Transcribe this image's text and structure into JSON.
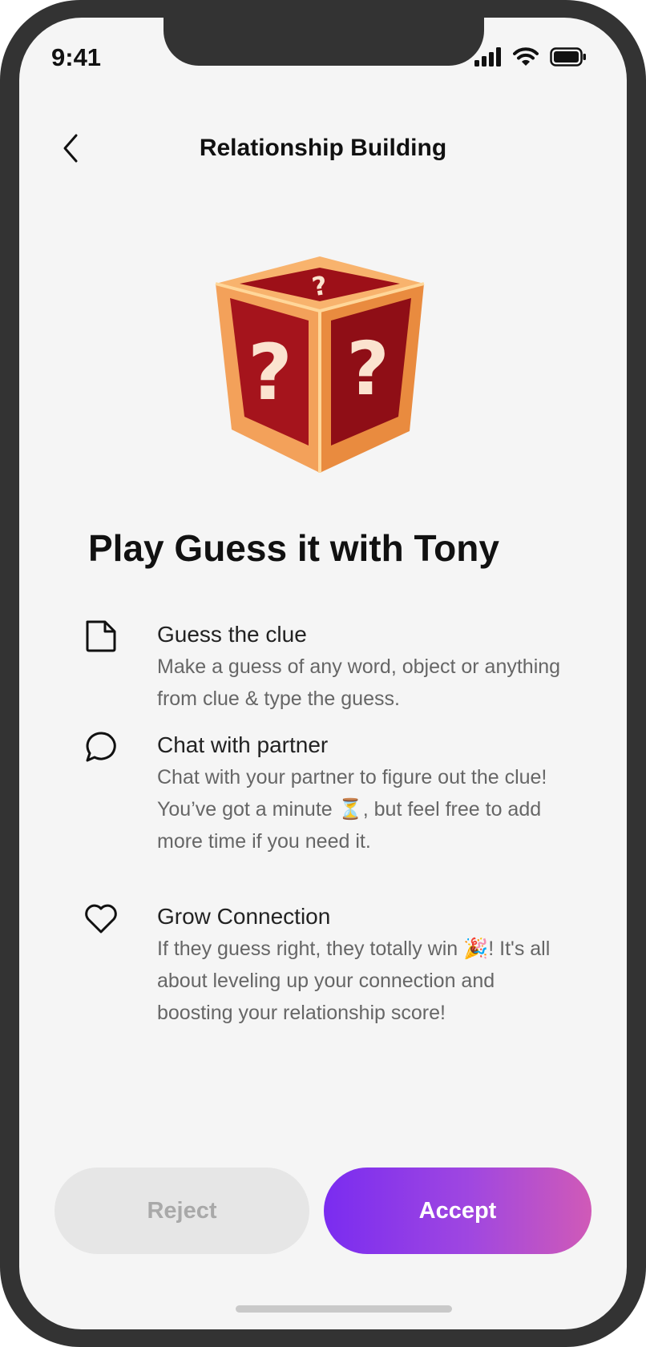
{
  "status_bar": {
    "time": "9:41"
  },
  "header": {
    "title": "Relationship Building"
  },
  "main": {
    "title": "Play Guess it with Tony"
  },
  "features": [
    {
      "icon": "document-icon",
      "title": "Guess the clue",
      "description": "Make a guess of any word, object or anything from clue & type the guess."
    },
    {
      "icon": "chat-bubble-icon",
      "title": "Chat with partner",
      "description": "Chat with your partner to figure out the clue! You’ve got a minute ⏳, but feel free to add more time if you need it."
    },
    {
      "icon": "heart-icon",
      "title": "Grow Connection",
      "description": "If they guess right, they totally win 🎉! It's all about leveling up your connection and boosting your relationship score!"
    }
  ],
  "actions": {
    "reject_label": "Reject",
    "accept_label": "Accept"
  },
  "colors": {
    "accent_start": "#7a2cf0",
    "accent_end": "#d05ab7",
    "reject_bg": "#e6e6e6",
    "box_red": "#a5141c",
    "box_frame": "#f6a35b"
  }
}
